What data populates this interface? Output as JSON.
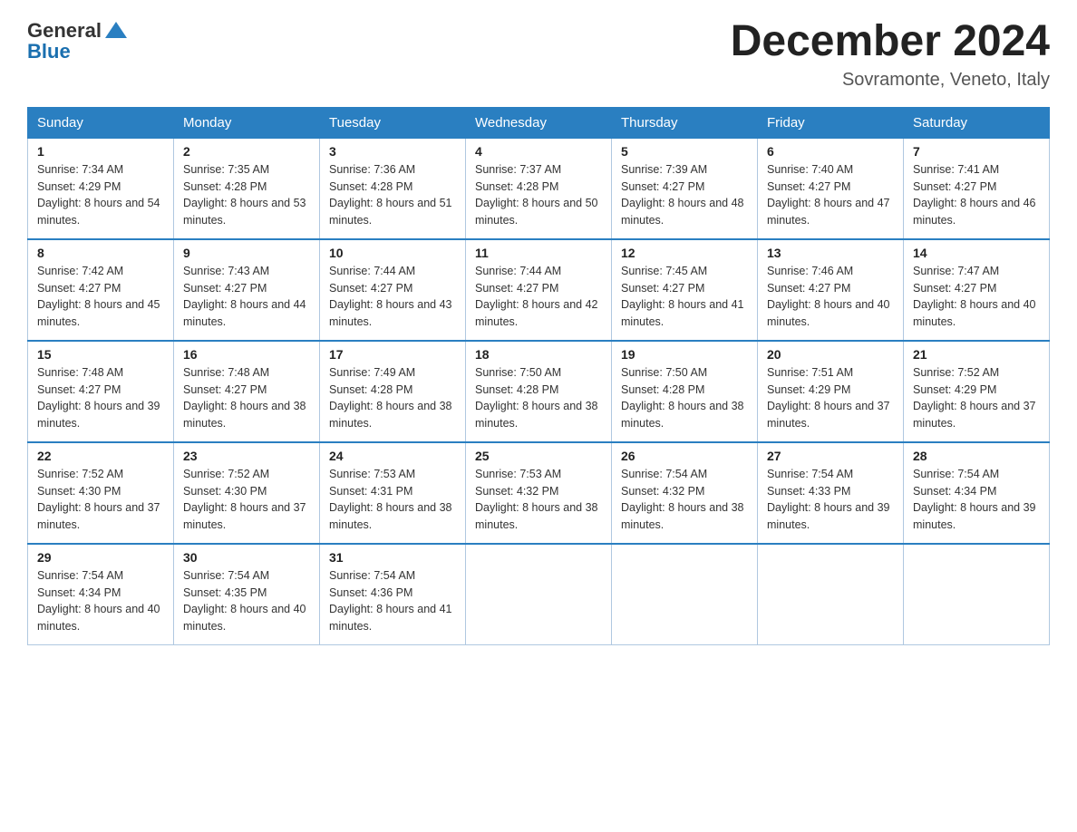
{
  "header": {
    "logo_general": "General",
    "logo_blue": "Blue",
    "month_title": "December 2024",
    "location": "Sovramonte, Veneto, Italy"
  },
  "days_of_week": [
    "Sunday",
    "Monday",
    "Tuesday",
    "Wednesday",
    "Thursday",
    "Friday",
    "Saturday"
  ],
  "weeks": [
    [
      {
        "day": "1",
        "sunrise": "7:34 AM",
        "sunset": "4:29 PM",
        "daylight": "8 hours and 54 minutes."
      },
      {
        "day": "2",
        "sunrise": "7:35 AM",
        "sunset": "4:28 PM",
        "daylight": "8 hours and 53 minutes."
      },
      {
        "day": "3",
        "sunrise": "7:36 AM",
        "sunset": "4:28 PM",
        "daylight": "8 hours and 51 minutes."
      },
      {
        "day": "4",
        "sunrise": "7:37 AM",
        "sunset": "4:28 PM",
        "daylight": "8 hours and 50 minutes."
      },
      {
        "day": "5",
        "sunrise": "7:39 AM",
        "sunset": "4:27 PM",
        "daylight": "8 hours and 48 minutes."
      },
      {
        "day": "6",
        "sunrise": "7:40 AM",
        "sunset": "4:27 PM",
        "daylight": "8 hours and 47 minutes."
      },
      {
        "day": "7",
        "sunrise": "7:41 AM",
        "sunset": "4:27 PM",
        "daylight": "8 hours and 46 minutes."
      }
    ],
    [
      {
        "day": "8",
        "sunrise": "7:42 AM",
        "sunset": "4:27 PM",
        "daylight": "8 hours and 45 minutes."
      },
      {
        "day": "9",
        "sunrise": "7:43 AM",
        "sunset": "4:27 PM",
        "daylight": "8 hours and 44 minutes."
      },
      {
        "day": "10",
        "sunrise": "7:44 AM",
        "sunset": "4:27 PM",
        "daylight": "8 hours and 43 minutes."
      },
      {
        "day": "11",
        "sunrise": "7:44 AM",
        "sunset": "4:27 PM",
        "daylight": "8 hours and 42 minutes."
      },
      {
        "day": "12",
        "sunrise": "7:45 AM",
        "sunset": "4:27 PM",
        "daylight": "8 hours and 41 minutes."
      },
      {
        "day": "13",
        "sunrise": "7:46 AM",
        "sunset": "4:27 PM",
        "daylight": "8 hours and 40 minutes."
      },
      {
        "day": "14",
        "sunrise": "7:47 AM",
        "sunset": "4:27 PM",
        "daylight": "8 hours and 40 minutes."
      }
    ],
    [
      {
        "day": "15",
        "sunrise": "7:48 AM",
        "sunset": "4:27 PM",
        "daylight": "8 hours and 39 minutes."
      },
      {
        "day": "16",
        "sunrise": "7:48 AM",
        "sunset": "4:27 PM",
        "daylight": "8 hours and 38 minutes."
      },
      {
        "day": "17",
        "sunrise": "7:49 AM",
        "sunset": "4:28 PM",
        "daylight": "8 hours and 38 minutes."
      },
      {
        "day": "18",
        "sunrise": "7:50 AM",
        "sunset": "4:28 PM",
        "daylight": "8 hours and 38 minutes."
      },
      {
        "day": "19",
        "sunrise": "7:50 AM",
        "sunset": "4:28 PM",
        "daylight": "8 hours and 38 minutes."
      },
      {
        "day": "20",
        "sunrise": "7:51 AM",
        "sunset": "4:29 PM",
        "daylight": "8 hours and 37 minutes."
      },
      {
        "day": "21",
        "sunrise": "7:52 AM",
        "sunset": "4:29 PM",
        "daylight": "8 hours and 37 minutes."
      }
    ],
    [
      {
        "day": "22",
        "sunrise": "7:52 AM",
        "sunset": "4:30 PM",
        "daylight": "8 hours and 37 minutes."
      },
      {
        "day": "23",
        "sunrise": "7:52 AM",
        "sunset": "4:30 PM",
        "daylight": "8 hours and 37 minutes."
      },
      {
        "day": "24",
        "sunrise": "7:53 AM",
        "sunset": "4:31 PM",
        "daylight": "8 hours and 38 minutes."
      },
      {
        "day": "25",
        "sunrise": "7:53 AM",
        "sunset": "4:32 PM",
        "daylight": "8 hours and 38 minutes."
      },
      {
        "day": "26",
        "sunrise": "7:54 AM",
        "sunset": "4:32 PM",
        "daylight": "8 hours and 38 minutes."
      },
      {
        "day": "27",
        "sunrise": "7:54 AM",
        "sunset": "4:33 PM",
        "daylight": "8 hours and 39 minutes."
      },
      {
        "day": "28",
        "sunrise": "7:54 AM",
        "sunset": "4:34 PM",
        "daylight": "8 hours and 39 minutes."
      }
    ],
    [
      {
        "day": "29",
        "sunrise": "7:54 AM",
        "sunset": "4:34 PM",
        "daylight": "8 hours and 40 minutes."
      },
      {
        "day": "30",
        "sunrise": "7:54 AM",
        "sunset": "4:35 PM",
        "daylight": "8 hours and 40 minutes."
      },
      {
        "day": "31",
        "sunrise": "7:54 AM",
        "sunset": "4:36 PM",
        "daylight": "8 hours and 41 minutes."
      },
      null,
      null,
      null,
      null
    ]
  ]
}
